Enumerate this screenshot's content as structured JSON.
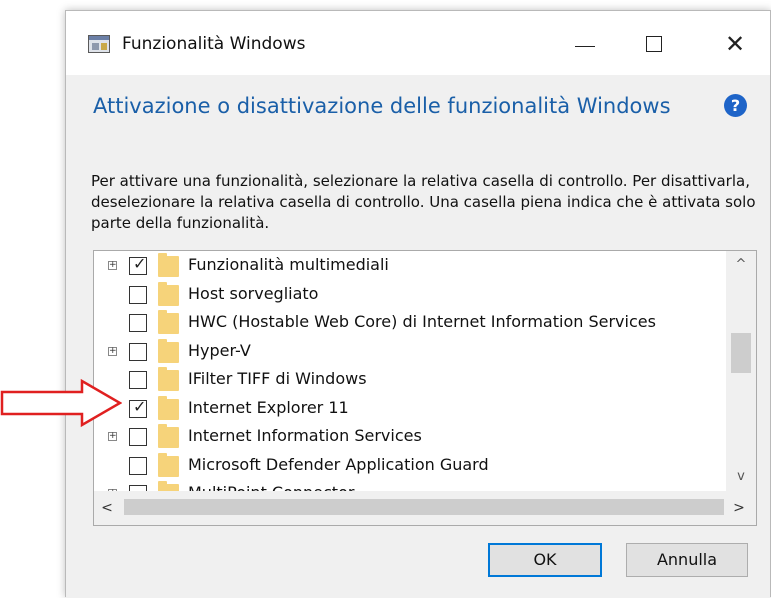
{
  "window": {
    "title": "Funzionalità Windows",
    "minimize_icon": "minimize-icon",
    "maximize_icon": "maximize-icon",
    "close_symbol": "✕"
  },
  "header": {
    "heading": "Attivazione o disattivazione delle funzionalità Windows",
    "help_symbol": "?",
    "description": "Per attivare una funzionalità, selezionare la relativa casella di controllo. Per disattivarla, deselezionare la relativa casella di controllo. Una casella piena indica che è attivata solo parte della funzionalità."
  },
  "features": [
    {
      "label": "Funzionalità multimediali",
      "checked": true,
      "expandable": true
    },
    {
      "label": "Host sorvegliato",
      "checked": false,
      "expandable": false
    },
    {
      "label": "HWC (Hostable Web Core) di Internet Information Services",
      "checked": false,
      "expandable": false
    },
    {
      "label": "Hyper-V",
      "checked": false,
      "expandable": true
    },
    {
      "label": "IFilter TIFF di Windows",
      "checked": false,
      "expandable": false
    },
    {
      "label": "Internet Explorer 11",
      "checked": true,
      "expandable": false
    },
    {
      "label": "Internet Information Services",
      "checked": false,
      "expandable": true
    },
    {
      "label": "Microsoft Defender Application Guard",
      "checked": false,
      "expandable": false
    },
    {
      "label": "MultiPoint Connector",
      "checked": false,
      "expandable": true
    }
  ],
  "scrollbars": {
    "up_symbol": "^",
    "down_symbol": "v",
    "left_symbol": "<",
    "right_symbol": ">"
  },
  "buttons": {
    "ok": "OK",
    "cancel": "Annulla"
  },
  "colors": {
    "heading": "#1a5fa8",
    "annotation_arrow": "#e02020",
    "ok_border": "#0078d7"
  }
}
